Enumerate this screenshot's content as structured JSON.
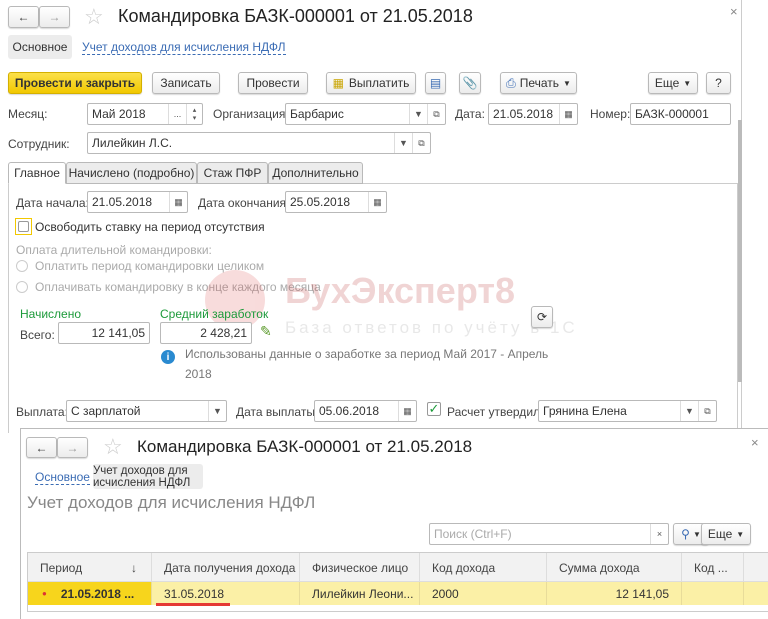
{
  "window1": {
    "title": "Командировка БАЗК-000001 от 21.05.2018",
    "nav_tabs": [
      "Основное",
      "Учет доходов для исчисления НДФЛ"
    ],
    "toolbar": {
      "post_close": "Провести и закрыть",
      "save": "Записать",
      "post": "Провести",
      "pay": "Выплатить",
      "print": "Печать",
      "more": "Еще",
      "help": "?"
    },
    "month_label": "Месяц:",
    "month_value": "Май 2018",
    "org_label": "Организация:",
    "org_value": "Барбарис",
    "date_label": "Дата:",
    "date_value": "21.05.2018",
    "number_label": "Номер:",
    "number_value": "БАЗК-000001",
    "employee_label": "Сотрудник:",
    "employee_value": "Лилейкин Л.С.",
    "tabs": [
      "Главное",
      "Начислено (подробно)",
      "Стаж ПФР",
      "Дополнительно"
    ],
    "start_label": "Дата начала:",
    "start_value": "21.05.2018",
    "end_label": "Дата окончания:",
    "end_value": "25.05.2018",
    "free_rate_label": "Освободить ставку на период отсутствия",
    "long_trip_label": "Оплата длительной командировки:",
    "radio1": "Оплатить период командировки целиком",
    "radio2": "Оплачивать командировку в конце каждого месяца",
    "accrued_label": "Начислено",
    "avg_label": "Средний заработок",
    "total_label": "Всего:",
    "total_value": "12 141,05",
    "avg_value": "2 428,21",
    "info_line1": "Использованы данные о заработке за период Май 2017 - Апрель",
    "info_line2": "2018",
    "payment_label": "Выплата:",
    "payment_value": "С зарплатой",
    "paydate_label": "Дата выплаты:",
    "paydate_value": "05.06.2018",
    "approved_label": "Расчет утвердил",
    "approved_value": "Грянина Елена",
    "watermark_title": "БухЭксперт8",
    "watermark_sub": "База ответов по учёту в 1С"
  },
  "window2": {
    "title": "Командировка БАЗК-000001 от 21.05.2018",
    "nav_tabs": [
      "Основное",
      "Учет доходов для исчисления НДФЛ"
    ],
    "heading": "Учет доходов для исчисления НДФЛ",
    "search_placeholder": "Поиск (Ctrl+F)",
    "more": "Еще",
    "columns": [
      "Период",
      "Дата получения дохода",
      "Физическое лицо",
      "Код дохода",
      "Сумма дохода",
      "Код ..."
    ],
    "rows": [
      {
        "period": "21.05.2018 ...",
        "date": "31.05.2018",
        "person": "Лилейкин Леони...",
        "code": "2000",
        "sum": "12 141,05",
        "code2": ""
      }
    ]
  },
  "colors": {
    "accent_yellow": "#f7d51c",
    "row_yellow": "#fbf0a6",
    "link": "#3b6cb4",
    "green_label": "#1c9a3a",
    "underline_red": "#e53935"
  }
}
